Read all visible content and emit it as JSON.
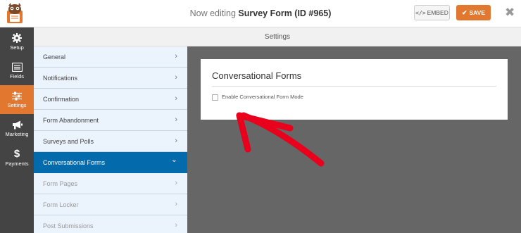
{
  "header": {
    "prefix": "Now editing",
    "form_name": "Survey Form (ID #965)",
    "embed_label": "EMBED",
    "save_label": "SAVE",
    "close_glyph": "✖"
  },
  "sidebar": {
    "items": [
      {
        "label": "Setup",
        "icon": "gear-icon"
      },
      {
        "label": "Fields",
        "icon": "list-icon"
      },
      {
        "label": "Settings",
        "icon": "sliders-icon"
      },
      {
        "label": "Marketing",
        "icon": "megaphone-icon"
      },
      {
        "label": "Payments",
        "icon": "dollar-icon"
      }
    ],
    "active": "Settings"
  },
  "settings_header": "Settings",
  "menu": {
    "items": [
      {
        "label": "General",
        "chevron": "›"
      },
      {
        "label": "Notifications",
        "chevron": "›"
      },
      {
        "label": "Confirmation",
        "chevron": "›"
      },
      {
        "label": "Form Abandonment",
        "chevron": "›"
      },
      {
        "label": "Surveys and Polls",
        "chevron": "›"
      },
      {
        "label": "Conversational Forms",
        "chevron": "⌄"
      },
      {
        "label": "Form Pages",
        "chevron": "›"
      },
      {
        "label": "Form Locker",
        "chevron": "›"
      },
      {
        "label": "Post Submissions",
        "chevron": "›"
      }
    ],
    "active": "Conversational Forms"
  },
  "panel": {
    "title": "Conversational Forms",
    "checkbox_label": "Enable Conversational Form Mode",
    "checked": false
  },
  "colors": {
    "accent": "#e27730",
    "active_menu": "#036aab",
    "menu_bg": "#ebf3fc",
    "sidebar_bg": "#444444",
    "content_bg": "#666666",
    "annotation": "#e8001c"
  }
}
